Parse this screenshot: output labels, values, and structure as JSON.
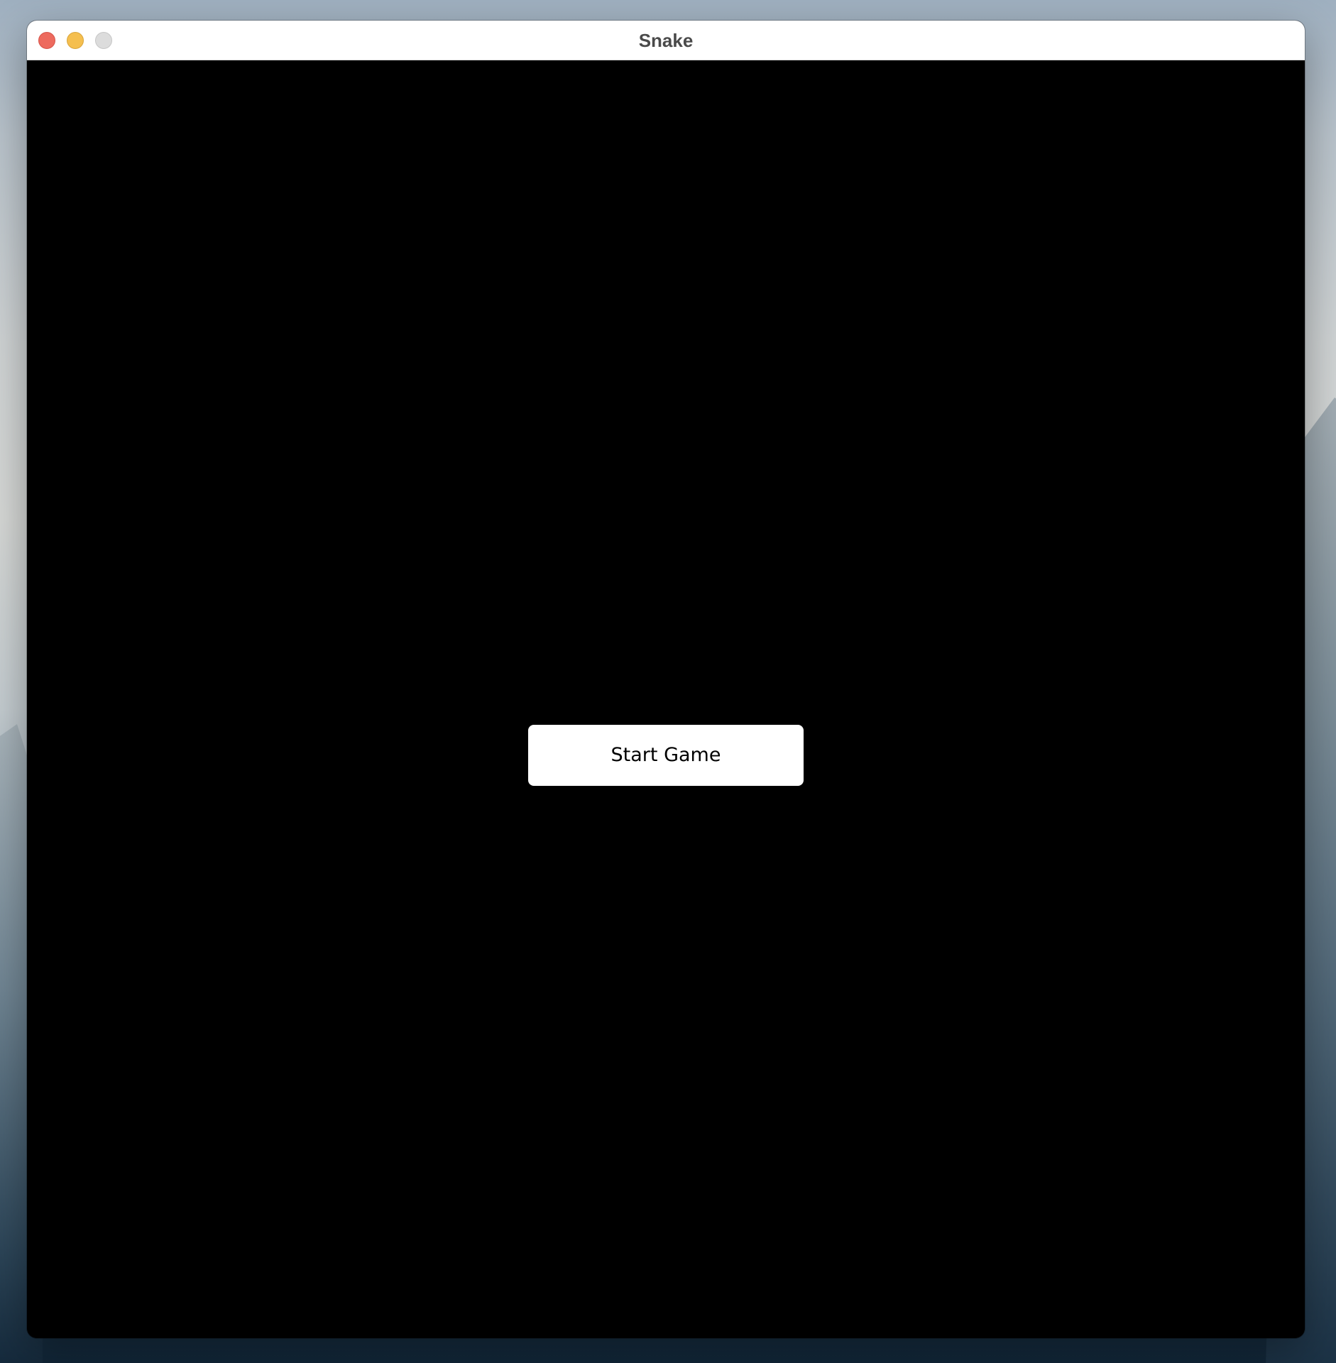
{
  "window": {
    "title": "Snake",
    "controls": {
      "close": {
        "icon": "close-traffic-light",
        "color": "#ed6a5e"
      },
      "minimize": {
        "icon": "minimize-traffic-light",
        "color": "#f5bf4f"
      },
      "zoom": {
        "icon": "zoom-traffic-light-disabled",
        "color": "#dcdcdc"
      }
    }
  },
  "game": {
    "background_color": "#000000",
    "start_button": {
      "label": "Start Game",
      "background_color": "#ffffff",
      "text_color": "#000000"
    }
  }
}
